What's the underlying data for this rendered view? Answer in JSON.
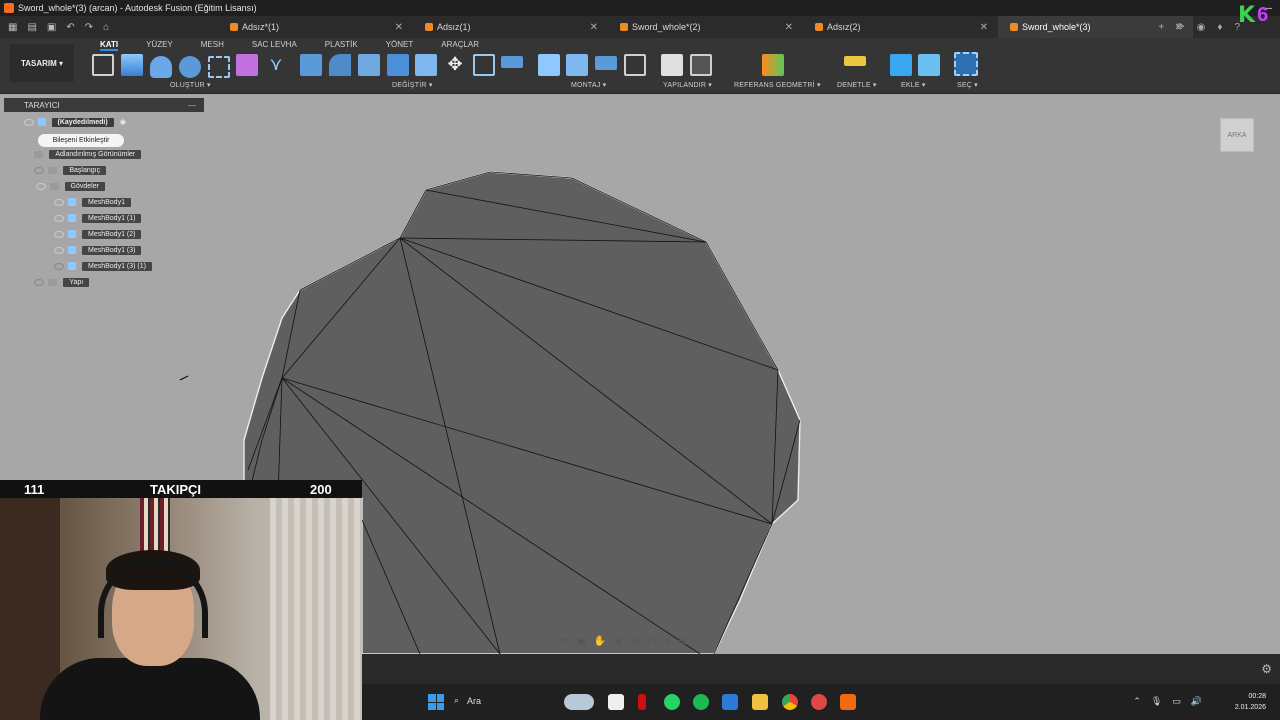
{
  "window": {
    "title": "Sword_whole*(3) (arcan) - Autodesk Fusion (Eğitim Lisansı)"
  },
  "tabs": [
    {
      "label": "Adsız*(1)",
      "active": false
    },
    {
      "label": "Adsız(1)",
      "active": false
    },
    {
      "label": "Sword_whole*(2)",
      "active": false
    },
    {
      "label": "Adsız(2)",
      "active": false
    },
    {
      "label": "Sword_whole*(3)",
      "active": true
    }
  ],
  "toolbar": {
    "workspace": "TASARIM",
    "ribbon_tabs": [
      "KATI",
      "YÜZEY",
      "MESH",
      "SAC LEVHA",
      "PLASTİK",
      "YÖNET",
      "ARAÇLAR"
    ],
    "groups": [
      "OLUŞTUR",
      "DEĞİŞTİR",
      "MONTAJ",
      "YAPILANDIR",
      "REFERANS GEOMETRİ",
      "DENETLE",
      "EKLE",
      "SEÇ"
    ]
  },
  "browser": {
    "title": "TARAYICI",
    "root": "(Kaydedilmedi)",
    "tooltip": "Bileşeni Etkinleştir",
    "items": {
      "named_views": "Adlandırılmış Görünümler",
      "origin": "Başlangıç",
      "bodies": "Gövdeler",
      "body1": "MeshBody1",
      "body2": "MeshBody1 (1)",
      "body3": "MeshBody1 (2)",
      "body4": "MeshBody1 (3)",
      "body5": "MeshBody1 (3) (1)",
      "construction": "Yapı"
    }
  },
  "viewcube": {
    "face": "ARKA"
  },
  "stream": {
    "count_left": "111",
    "label": "TAKIPÇI",
    "count_right": "200"
  },
  "taskbar": {
    "search_placeholder": "Ara",
    "time": "00:28",
    "date": "2.01.2026"
  },
  "colors": {
    "accent": "#2b8ff0",
    "canvas_bg": "#a7a7a7",
    "mesh_fill": "#5f5f5f",
    "tab_cube": "#f08a24"
  }
}
